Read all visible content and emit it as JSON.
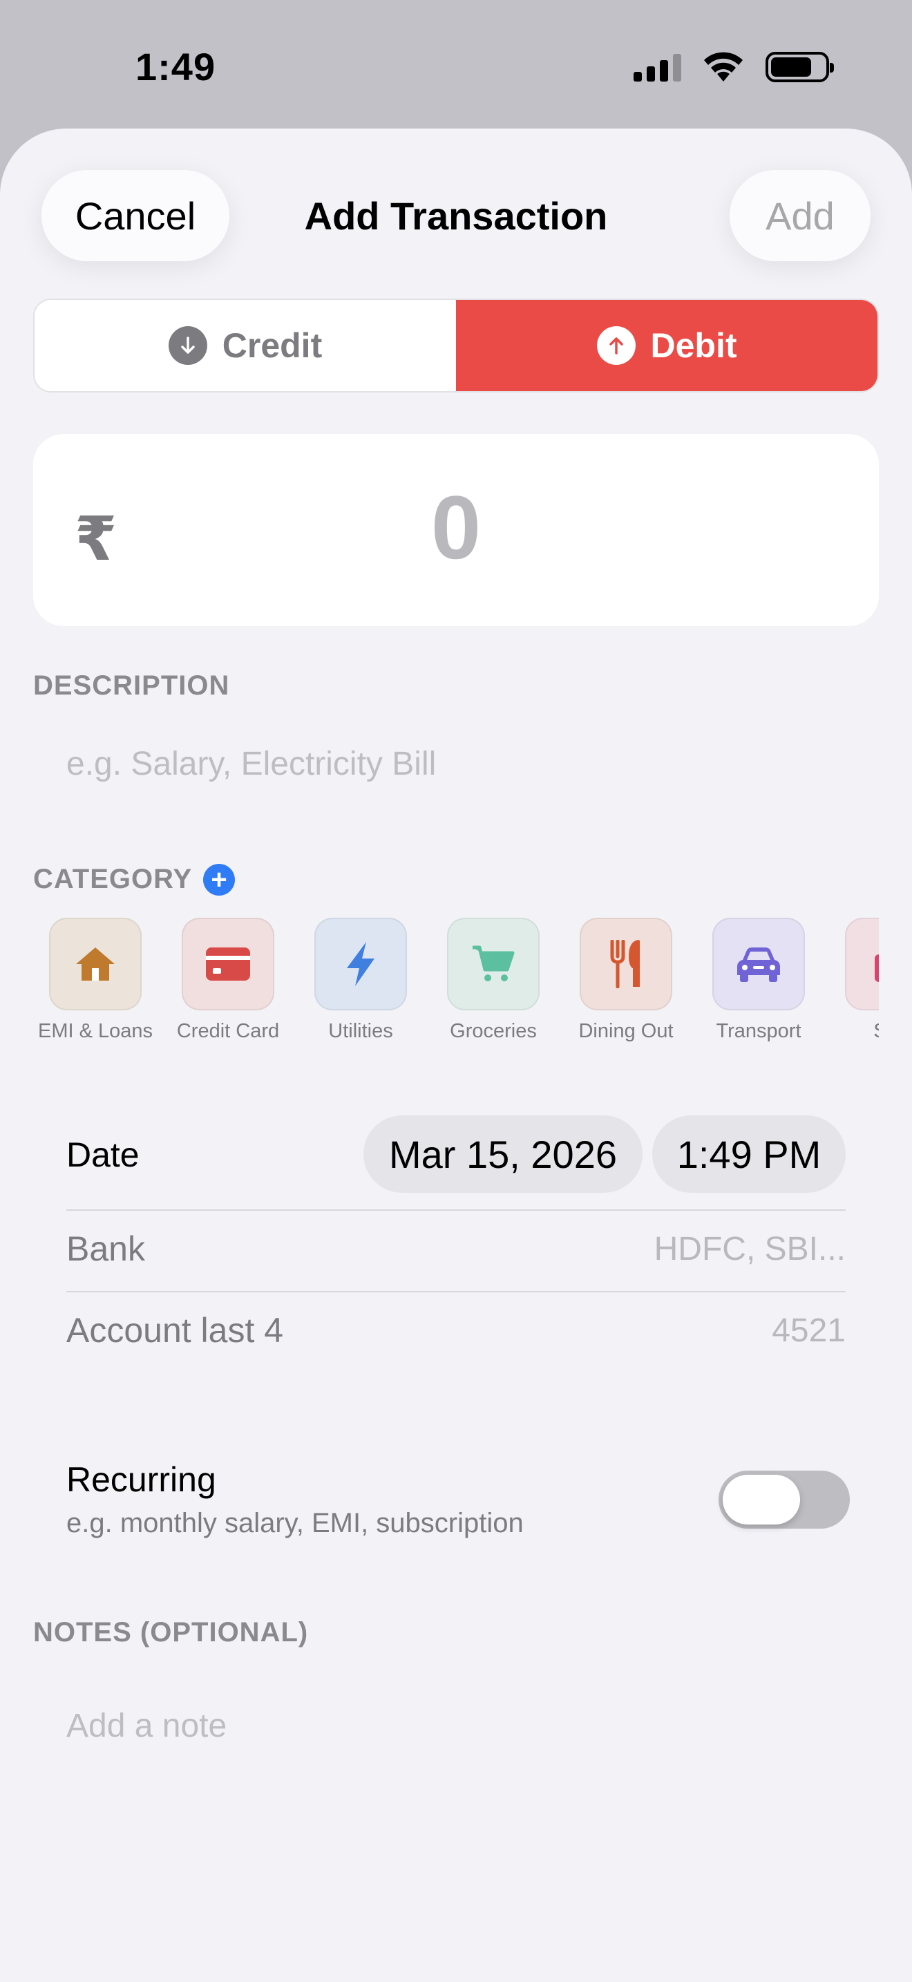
{
  "status": {
    "time": "1:49"
  },
  "header": {
    "cancel": "Cancel",
    "title": "Add Transaction",
    "add": "Add"
  },
  "type_toggle": {
    "credit": "Credit",
    "debit": "Debit",
    "selected": "Debit"
  },
  "amount": {
    "currency": "₹",
    "value": "0"
  },
  "description": {
    "label": "DESCRIPTION",
    "placeholder": "e.g. Salary, Electricity Bill"
  },
  "category": {
    "label": "CATEGORY",
    "items": [
      {
        "label": "EMI & Loans",
        "icon": "house-icon",
        "bg": "#ece3da",
        "color": "#c07a2e"
      },
      {
        "label": "Credit Card",
        "icon": "credit-card-icon",
        "bg": "#f1dede",
        "color": "#d84a47"
      },
      {
        "label": "Utilities",
        "icon": "bolt-icon",
        "bg": "#dde5f2",
        "color": "#3f7fe0"
      },
      {
        "label": "Groceries",
        "icon": "cart-icon",
        "bg": "#dfece8",
        "color": "#5cc0a0"
      },
      {
        "label": "Dining Out",
        "icon": "fork-knife-icon",
        "bg": "#f0dfda",
        "color": "#d4572f"
      },
      {
        "label": "Transport",
        "icon": "car-icon",
        "bg": "#e3e1f3",
        "color": "#6f63d6"
      },
      {
        "label": "Sho",
        "icon": "shopping-icon",
        "bg": "#f1dfe4",
        "color": "#d8456c"
      }
    ]
  },
  "details": {
    "date_label": "Date",
    "date_value": "Mar 15, 2026",
    "time_value": "1:49 PM",
    "bank_label": "Bank",
    "bank_placeholder": "HDFC, SBI...",
    "account_label": "Account last 4",
    "account_placeholder": "4521"
  },
  "recurring": {
    "label": "Recurring",
    "hint": "e.g. monthly salary, EMI, subscription",
    "enabled": false
  },
  "notes": {
    "label": "NOTES (OPTIONAL)",
    "placeholder": "Add a note"
  }
}
